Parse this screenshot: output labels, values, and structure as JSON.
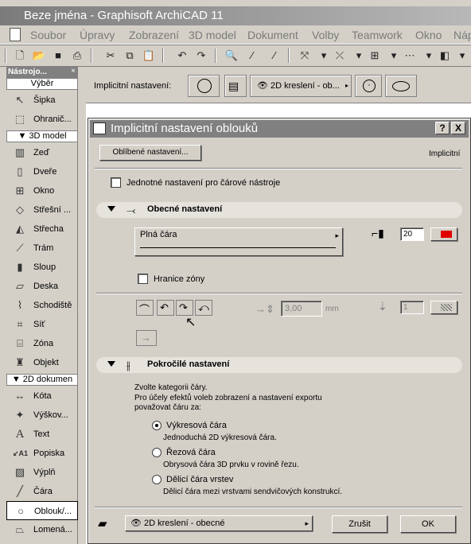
{
  "window": {
    "title": "Beze jména - Graphisoft ArchiCAD 11"
  },
  "menu": [
    "Soubor",
    "Úpravy",
    "Zobrazení",
    "3D model",
    "Dokument",
    "Volby",
    "Teamwork",
    "Okno",
    "Náp"
  ],
  "palette": {
    "title": "Nástrojo...",
    "close": "×",
    "select_header": "Výběr",
    "groups": [
      {
        "label": "3D model",
        "items": [
          "Zeď",
          "Dveře",
          "Okno",
          "Střešní ...",
          "Střecha",
          "Trám",
          "Sloup",
          "Deska",
          "Schodiště",
          "Síť",
          "Zóna",
          "Objekt"
        ]
      },
      {
        "label": "2D dokumen",
        "items": [
          "Kóta",
          "Výškov...",
          "Text",
          "Popiska",
          "Výplň",
          "Čára",
          "Oblouk/...",
          "Lomená..."
        ]
      }
    ],
    "top_items": [
      "Šipka",
      "Ohranič..."
    ],
    "selected": "Oblouk/..."
  },
  "infobox": {
    "label": "Implicitní nastavení:",
    "layer": "2D kreslení - ob..."
  },
  "dialog": {
    "title": "Implicitní nastavení oblouků",
    "help": "?",
    "close": "X",
    "favorites_button": "Oblíbené nastavení...",
    "mode_label": "Implicitní",
    "uniform_checkbox": "Jednotné nastavení pro čárové nástroje",
    "general_section": "Obecné nastavení",
    "line_type": "Plná čára",
    "pen_number": "20",
    "pen_color": "#e00000",
    "zone_boundary": "Hranice zóny",
    "arrow_size": "3,00",
    "arrow_unit": "mm",
    "arrow_pen": "1",
    "advanced_section": "Pokročilé nastavení",
    "category_intro": "Zvolte kategorii čáry.",
    "category_desc": "Pro účely efektů voleb zobrazení a nastavení exportu považovat čáru za:",
    "options": [
      {
        "label": "Výkresová čára",
        "desc": "Jednoduchá 2D výkresová čára.",
        "selected": true
      },
      {
        "label": "Řezová čára",
        "desc": "Obrysová čára 3D prvku v rovině řezu.",
        "selected": false
      },
      {
        "label": "Dělicí čára vrstev",
        "desc": "Dělicí čára mezi vrstvami sendvičových konstrukcí.",
        "selected": false
      }
    ],
    "layer": "2D kreslení - obecné",
    "cancel": "Zrušit",
    "ok": "OK"
  }
}
